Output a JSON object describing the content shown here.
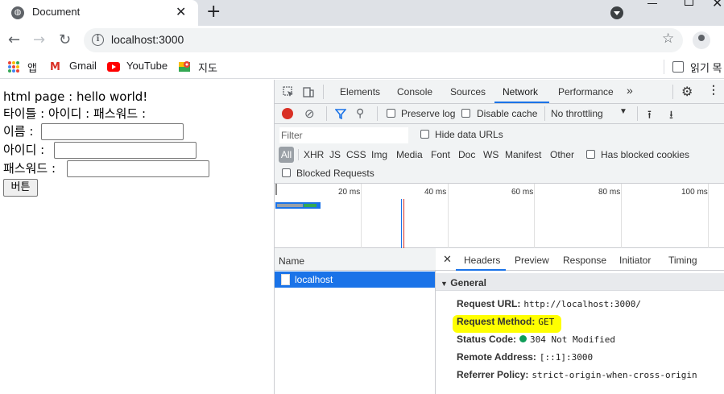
{
  "browser": {
    "tab_title": "Document",
    "url": "localhost:3000",
    "bookmarks": [
      "앱",
      "Gmail",
      "YouTube",
      "지도"
    ],
    "reading_list": "읽기 목"
  },
  "page": {
    "line1": "html page : hello world!",
    "line2": "타이틀 : 아이디 : 패스워드 :",
    "name_label": "이름 :",
    "id_label": "아이디 :",
    "pw_label": "패스워드 :",
    "button": "버튼"
  },
  "devtools": {
    "tabs": [
      "Elements",
      "Console",
      "Sources",
      "Network",
      "Performance"
    ],
    "active_tab": "Network",
    "toolbar": {
      "preserve_log": "Preserve log",
      "disable_cache": "Disable cache",
      "throttling": "No throttling"
    },
    "filter": {
      "placeholder": "Filter",
      "hide_data_urls": "Hide data URLs",
      "types": [
        "All",
        "XHR",
        "JS",
        "CSS",
        "Img",
        "Media",
        "Font",
        "Doc",
        "WS",
        "Manifest",
        "Other"
      ],
      "has_blocked_cookies": "Has blocked cookies",
      "blocked_requests": "Blocked Requests"
    },
    "timeline_ticks": [
      "20 ms",
      "40 ms",
      "60 ms",
      "80 ms",
      "100 ms"
    ],
    "name_header": "Name",
    "requests": [
      "localhost"
    ],
    "detail_tabs": [
      "Headers",
      "Preview",
      "Response",
      "Initiator",
      "Timing"
    ],
    "general": {
      "title": "General",
      "fields": [
        {
          "key": "Request URL:",
          "value": "http://localhost:3000/"
        },
        {
          "key": "Request Method:",
          "value": "GET"
        },
        {
          "key": "Status Code:",
          "value": "304 Not Modified"
        },
        {
          "key": "Remote Address:",
          "value": "[::1]:3000"
        },
        {
          "key": "Referrer Policy:",
          "value": "strict-origin-when-cross-origin"
        }
      ]
    }
  },
  "colors": {
    "accent": "#1a73e8",
    "highlight": "#ffff00",
    "status_ok": "#0f9d58",
    "record": "#d93025"
  }
}
